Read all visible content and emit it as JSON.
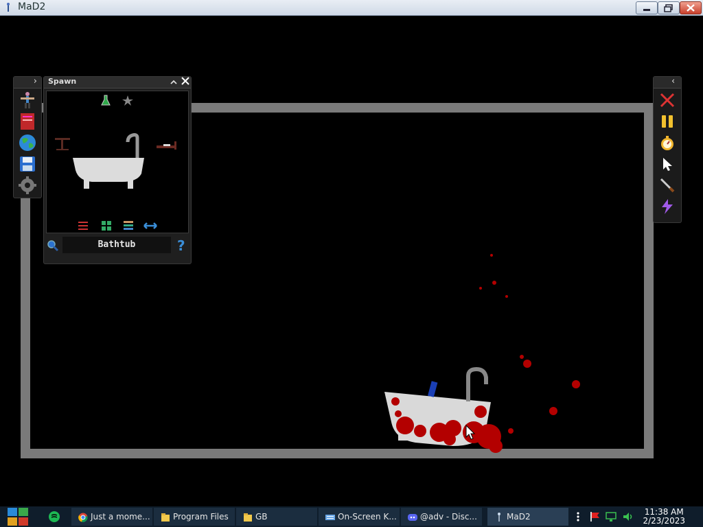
{
  "window": {
    "title": "MaD2"
  },
  "left_panel": {
    "toggle_glyph": "›"
  },
  "spawn": {
    "title": "Spawn",
    "search_value": "Bathtub",
    "help_glyph": "?"
  },
  "right_panel": {
    "toggle_glyph": "‹"
  },
  "taskbar": {
    "items": [
      {
        "label": "Just a mome..."
      },
      {
        "label": "Program Files"
      },
      {
        "label": "GB"
      },
      {
        "label": "On-Screen K..."
      },
      {
        "label": "@adv - Disc..."
      },
      {
        "label": "MaD2"
      }
    ],
    "clock": {
      "time": "11:38 AM",
      "date": "2/23/2023"
    }
  },
  "colors": {
    "arena_border": "#7a7a7a",
    "blood": "#b30000",
    "taskbar": "#0f1d2b"
  }
}
